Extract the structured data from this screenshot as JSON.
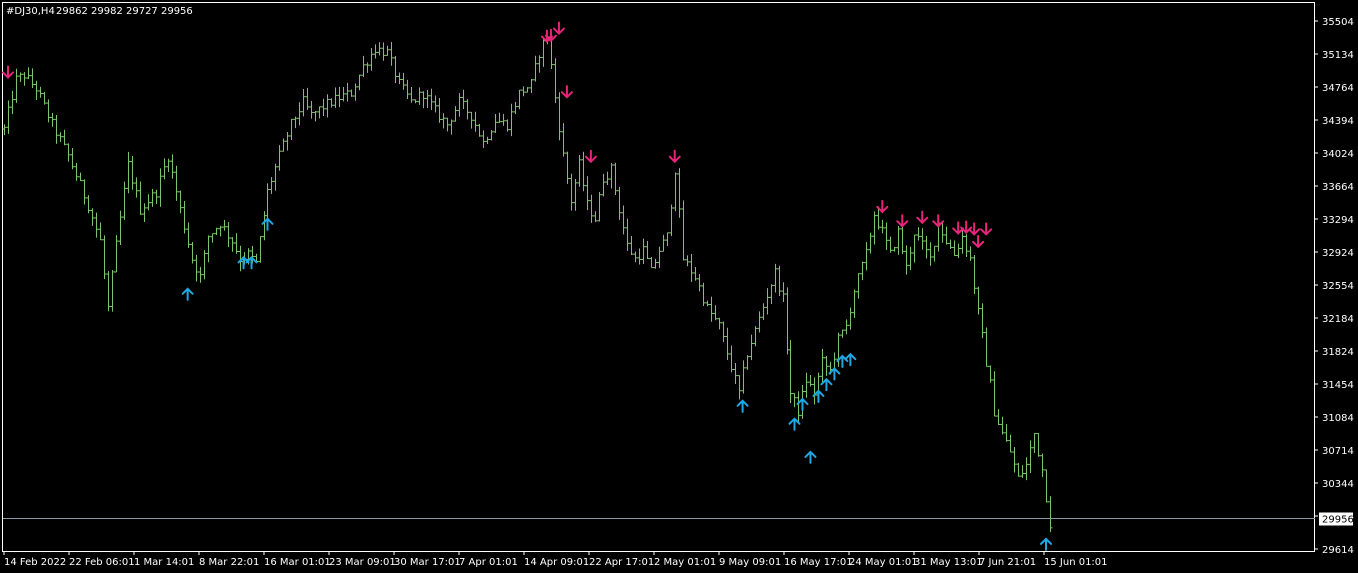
{
  "header": {
    "symbol_timeframe": "#DJ30,H4",
    "ohlc": "29862 29982 29727 29956"
  },
  "colors": {
    "background": "#000000",
    "frame": "#ffffff",
    "bars": "#7cc46b",
    "arrow_up": "#1fa7e4",
    "arrow_down": "#e6247a",
    "price_line": "#8899aa"
  },
  "chart_data": {
    "type": "line",
    "subtype": "ohlc-bars",
    "ylim": [
      29500,
      35650
    ],
    "y_ticks": [
      "35504",
      "35134",
      "34764",
      "34394",
      "34024",
      "33664",
      "33294",
      "32924",
      "32554",
      "32184",
      "31824",
      "31454",
      "31084",
      "30714",
      "30344",
      "29974",
      "29614"
    ],
    "x_ticks": [
      "14 Feb 2022",
      "22 Feb 06:01",
      "1 Mar 14:01",
      "8 Mar 22:01",
      "16 Mar 01:01",
      "23 Mar 09:01",
      "30 Mar 17:01",
      "7 Apr 01:01",
      "14 Apr 09:01",
      "22 Apr 17:01",
      "2 May 01:01",
      "9 May 09:01",
      "16 May 17:01",
      "24 May 01:01",
      "31 May 13:01",
      "7 Jun 21:01",
      "15 Jun 01:01"
    ],
    "current_price": "29956",
    "price_path": [
      [
        0,
        34300
      ],
      [
        3,
        34850
      ],
      [
        5,
        34900
      ],
      [
        8,
        34750
      ],
      [
        12,
        34350
      ],
      [
        16,
        34000
      ],
      [
        21,
        33450
      ],
      [
        24,
        33050
      ],
      [
        26,
        32300
      ],
      [
        28,
        33000
      ],
      [
        31,
        33900
      ],
      [
        34,
        33400
      ],
      [
        38,
        33600
      ],
      [
        41,
        34000
      ],
      [
        44,
        33400
      ],
      [
        47,
        32850
      ],
      [
        49,
        32650
      ],
      [
        51,
        33100
      ],
      [
        54,
        33250
      ],
      [
        57,
        33050
      ],
      [
        59,
        32850
      ],
      [
        61,
        32900
      ],
      [
        63,
        32800
      ],
      [
        66,
        33600
      ],
      [
        69,
        34000
      ],
      [
        72,
        34350
      ],
      [
        75,
        34600
      ],
      [
        77,
        34450
      ],
      [
        80,
        34550
      ],
      [
        84,
        34650
      ],
      [
        87,
        34700
      ],
      [
        90,
        35000
      ],
      [
        93,
        35200
      ],
      [
        96,
        35150
      ],
      [
        99,
        34800
      ],
      [
        102,
        34600
      ],
      [
        105,
        34700
      ],
      [
        108,
        34500
      ],
      [
        111,
        34350
      ],
      [
        114,
        34600
      ],
      [
        117,
        34450
      ],
      [
        120,
        34150
      ],
      [
        123,
        34400
      ],
      [
        126,
        34350
      ],
      [
        129,
        34700
      ],
      [
        132,
        34800
      ],
      [
        134,
        35150
      ],
      [
        136,
        35350
      ],
      [
        138,
        34650
      ],
      [
        140,
        34000
      ],
      [
        142,
        33500
      ],
      [
        144,
        33900
      ],
      [
        146,
        33450
      ],
      [
        148,
        33300
      ],
      [
        150,
        33750
      ],
      [
        152,
        33850
      ],
      [
        154,
        33400
      ],
      [
        156,
        33000
      ],
      [
        158,
        32850
      ],
      [
        160,
        32950
      ],
      [
        162,
        32700
      ],
      [
        164,
        32950
      ],
      [
        166,
        33100
      ],
      [
        168,
        33850
      ],
      [
        170,
        32850
      ],
      [
        173,
        32650
      ],
      [
        176,
        32300
      ],
      [
        179,
        32100
      ],
      [
        182,
        31650
      ],
      [
        184,
        31350
      ],
      [
        186,
        31800
      ],
      [
        188,
        32050
      ],
      [
        191,
        32450
      ],
      [
        193,
        32700
      ],
      [
        195,
        32400
      ],
      [
        197,
        31350
      ],
      [
        199,
        31150
      ],
      [
        201,
        31500
      ],
      [
        203,
        31350
      ],
      [
        205,
        31700
      ],
      [
        207,
        31600
      ],
      [
        209,
        31950
      ],
      [
        211,
        32100
      ],
      [
        213,
        32500
      ],
      [
        216,
        32900
      ],
      [
        218,
        33350
      ],
      [
        220,
        33150
      ],
      [
        222,
        32900
      ],
      [
        224,
        33150
      ],
      [
        226,
        32750
      ],
      [
        228,
        33150
      ],
      [
        230,
        33000
      ],
      [
        232,
        32850
      ],
      [
        234,
        33250
      ],
      [
        236,
        33050
      ],
      [
        238,
        32900
      ],
      [
        240,
        33100
      ],
      [
        242,
        32850
      ],
      [
        244,
        32250
      ],
      [
        246,
        31700
      ],
      [
        247,
        31450
      ],
      [
        248,
        31150
      ],
      [
        250,
        30900
      ],
      [
        252,
        30700
      ],
      [
        254,
        30400
      ],
      [
        256,
        30550
      ],
      [
        258,
        30900
      ],
      [
        260,
        30500
      ],
      [
        262,
        29900
      ]
    ],
    "signals_up": [
      [
        46,
        32450
      ],
      [
        60,
        32800
      ],
      [
        62,
        32800
      ],
      [
        66,
        33230
      ],
      [
        185,
        31200
      ],
      [
        198,
        31000
      ],
      [
        200,
        31220
      ],
      [
        202,
        30630
      ],
      [
        204,
        31310
      ],
      [
        206,
        31440
      ],
      [
        208,
        31560
      ],
      [
        210,
        31700
      ],
      [
        212,
        31720
      ],
      [
        261,
        29660
      ]
    ],
    "signals_down": [
      [
        1,
        34930
      ],
      [
        136,
        35330
      ],
      [
        137,
        35340
      ],
      [
        139,
        35420
      ],
      [
        141,
        34710
      ],
      [
        147,
        33990
      ],
      [
        168,
        33990
      ],
      [
        220,
        33430
      ],
      [
        225,
        33270
      ],
      [
        230,
        33310
      ],
      [
        234,
        33270
      ],
      [
        239,
        33190
      ],
      [
        241,
        33200
      ],
      [
        243,
        33180
      ],
      [
        244,
        33040
      ],
      [
        246,
        33180
      ]
    ]
  }
}
